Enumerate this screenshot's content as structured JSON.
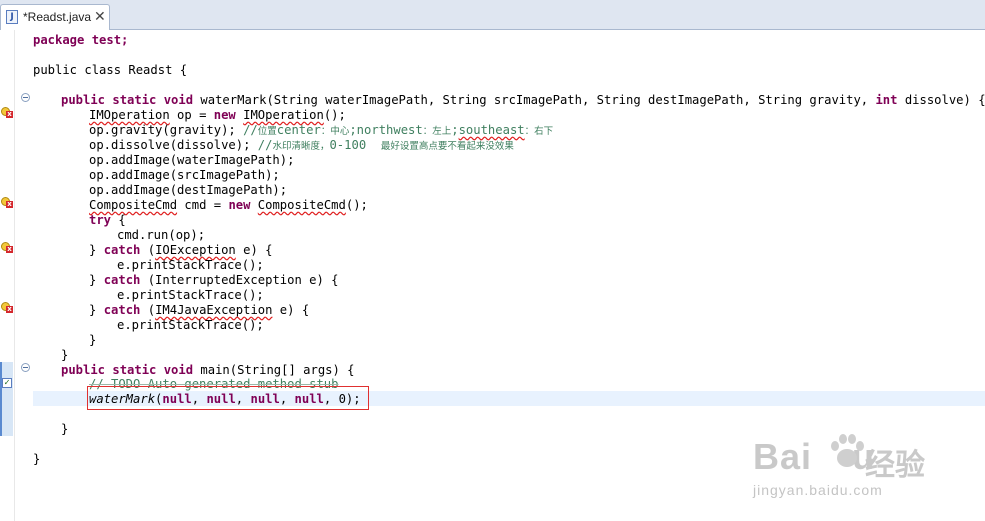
{
  "editor": {
    "tab": {
      "title": "*Readst.java",
      "close": "✕",
      "icon": "java-file-icon"
    }
  },
  "code": {
    "line_package": "package test;",
    "line_class": "public class Readst {",
    "wm": {
      "sig_kw": "public static void",
      "sig_rest": " waterMark(String waterImagePath, String srcImagePath, String destImagePath, String gravity, ",
      "sig_int": "int",
      "sig_end": " dissolve) {",
      "op_type": "IMOperation",
      "op_mid": " op = ",
      "op_new": "new",
      "op_sp": " ",
      "op_ctor": "IMOperation",
      "op_end": "();",
      "grav_code": "op.gravity(gravity); ",
      "grav_c1": "//",
      "grav_cn1": "位置",
      "grav_c2": "center",
      "grav_cn2": "：中心",
      "grav_c3": ";northwest",
      "grav_cn3": "：左上",
      "grav_c4": ";",
      "grav_c5": "southeast",
      "grav_cn4": "：右下",
      "dis_code": "op.dissolve(dissolve); ",
      "dis_c1": "//",
      "dis_cn1": "水印清晰度，",
      "dis_c2": "0-100  ",
      "dis_cn2": "最好设置高点要不看起来没效果",
      "add1": "op.addImage(waterImagePath);",
      "add2": "op.addImage(srcImagePath);",
      "add3": "op.addImage(destImagePath);",
      "cmd_type": "CompositeCmd",
      "cmd_mid": " cmd = ",
      "cmd_new": "new",
      "cmd_sp": " ",
      "cmd_ctor": "CompositeCmd",
      "cmd_end": "();",
      "try_kw": "try",
      "try_end": " {",
      "run": "cmd.run(op);",
      "c1_open": "} ",
      "c1_kw": "catch",
      "c1_mid": " (",
      "c1_ex": "IOException",
      "c1_end": " e) {",
      "pst1": "e.printStackTrace();",
      "c2_open": "} ",
      "c2_kw": "catch",
      "c2_rest": " (InterruptedException e) {",
      "pst2": "e.printStackTrace();",
      "c3_open": "} ",
      "c3_kw": "catch",
      "c3_mid": " (",
      "c3_ex": "IM4JavaException",
      "c3_end": " e) {",
      "pst3": "e.printStackTrace();",
      "close_inner": "}",
      "close_method": "}"
    },
    "main": {
      "sig_kw": "public static void",
      "sig_rest": " main(String[] args) {",
      "todo": "// TODO Auto-generated method stub",
      "call_name": "waterMark",
      "call_args_open": "(",
      "null1": "null",
      "sep1": ", ",
      "null2": "null",
      "sep2": ", ",
      "null3": "null",
      "sep3": ", ",
      "null4": "null",
      "call_end": ", 0);",
      "close": "}"
    },
    "close_class": "}"
  },
  "watermark": {
    "logo_text": "Bai",
    "logo_tail": "u",
    "cn_text": "经验",
    "url": "jingyan.baidu.com"
  },
  "colors": {
    "keyword": "#7f0055",
    "comment": "#3f7f5f",
    "error_underline": "#e02020",
    "highlight_box": "#e03030"
  }
}
